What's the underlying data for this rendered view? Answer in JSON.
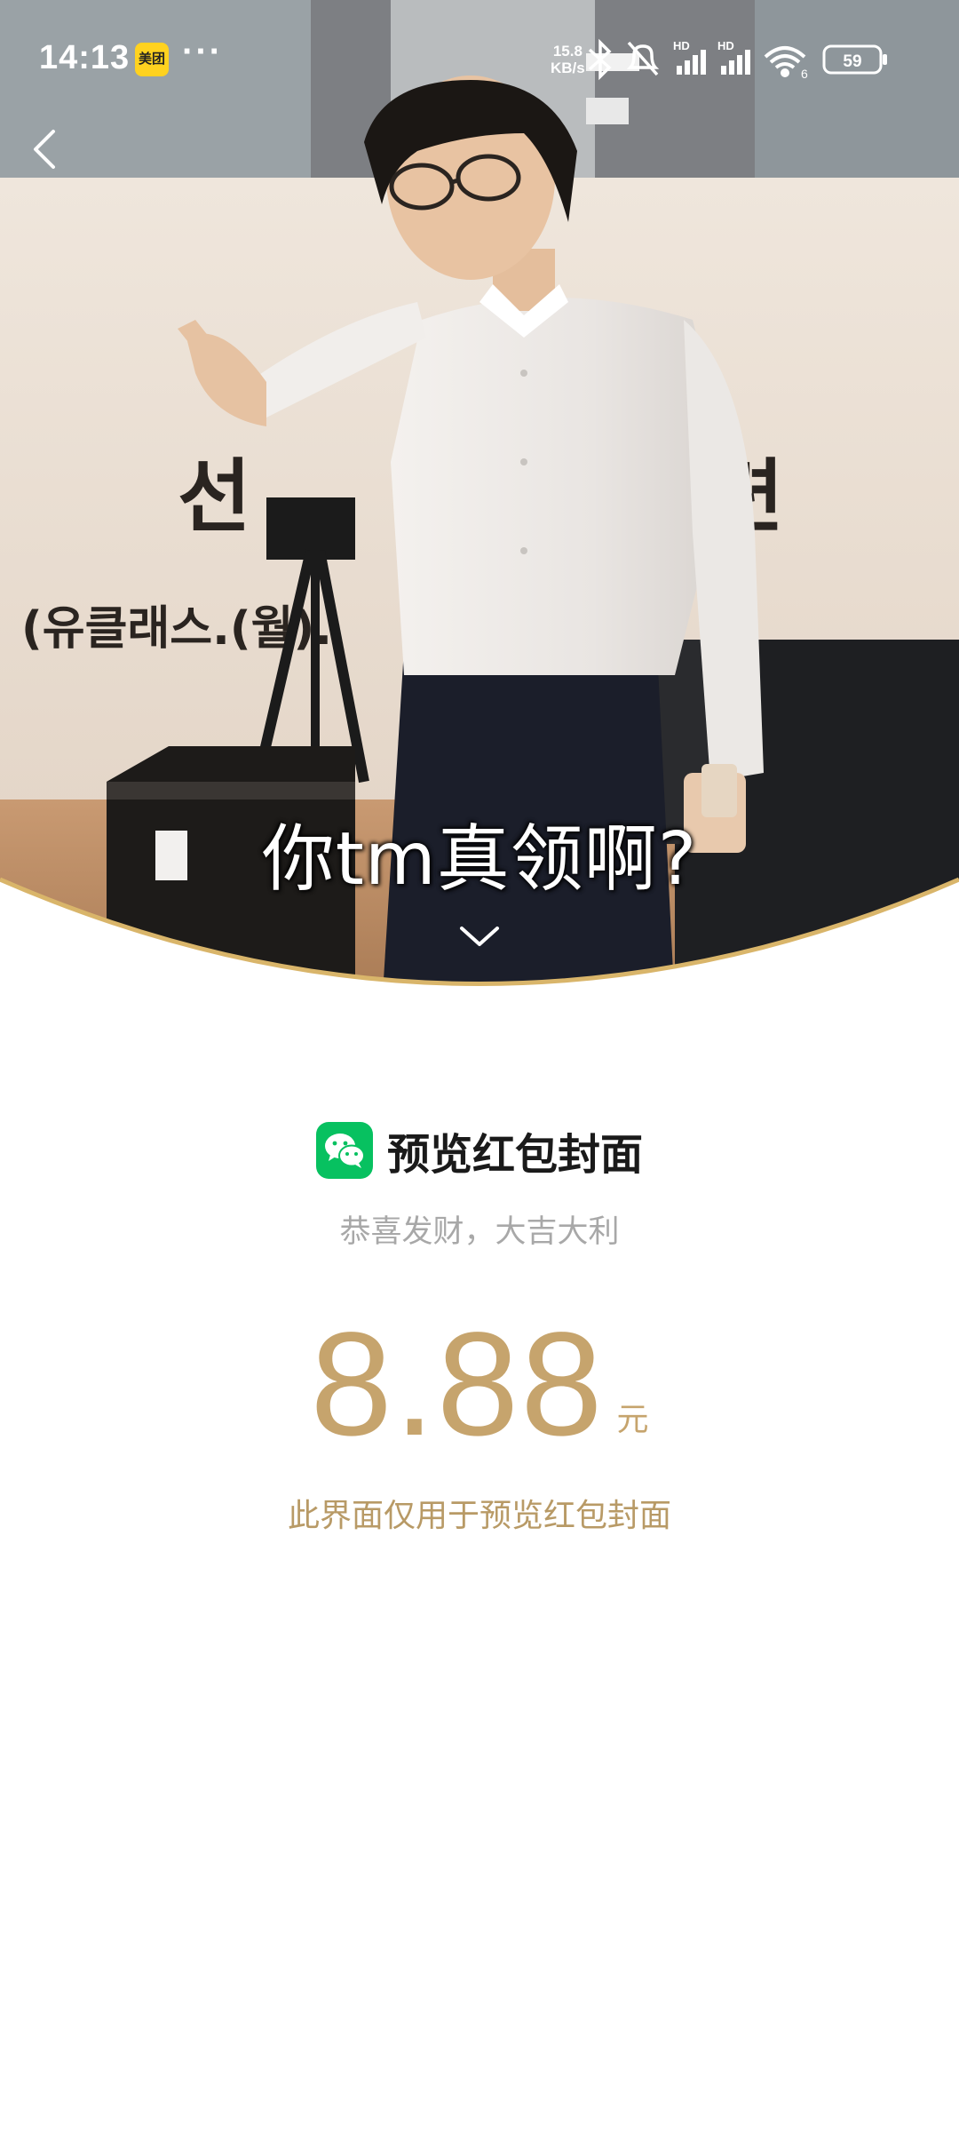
{
  "status_bar": {
    "time": "14:13",
    "app_badge": "美团",
    "more": "···",
    "net_speed_value": "15.8",
    "net_speed_unit": "KB/s",
    "battery": "59",
    "wifi_label": "6",
    "hd1": "HD",
    "hd2": "HD"
  },
  "cover": {
    "caption": "你tm真领啊?",
    "sign_left": "선",
    "sign_right": "련",
    "sign_sub": "(유클래스.(월)."
  },
  "info": {
    "title": "预览红包封面",
    "subtitle": "恭喜发财，大吉大利",
    "amount": "8.88",
    "unit": "元",
    "note": "此界面仅用于预览红包封面"
  },
  "colors": {
    "gold": "#c6a46d",
    "wechat_green": "#07c160",
    "arc_gold": "#d9b56a"
  },
  "icons": {
    "back": "chevron-left-icon",
    "expand": "chevron-down-icon",
    "brand": "wechat-icon"
  }
}
